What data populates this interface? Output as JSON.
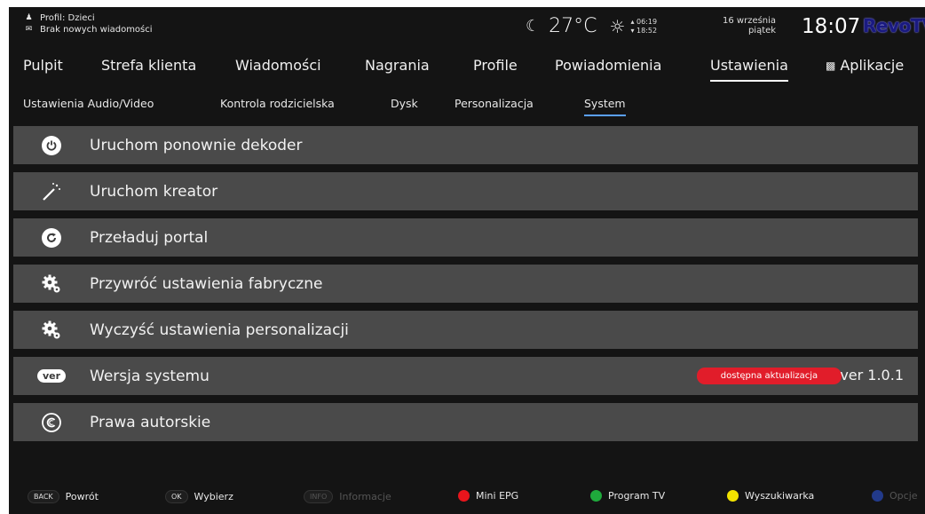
{
  "status": {
    "profile_label": "Profil: Dzieci",
    "messages_label": "Brak nowych wiadomości",
    "temperature": "27°C",
    "sunrise": "06:19",
    "sunset": "18:52",
    "date": "16 września",
    "weekday": "piątek",
    "time": "18:07",
    "brand": "RevoTV"
  },
  "main_nav": {
    "tabs": [
      "Pulpit",
      "Strefa klienta",
      "Wiadomości",
      "Nagrania",
      "Profile",
      "Powiadomienia",
      "Ustawienia",
      "Aplikacje"
    ],
    "active": "Ustawienia"
  },
  "sub_nav": {
    "tabs": [
      "Ustawienia Audio/Video",
      "Kontrola rodzicielska",
      "Dysk",
      "Personalizacja",
      "System"
    ],
    "active": "System"
  },
  "menu": {
    "items": [
      {
        "label": "Uruchom ponownie dekoder",
        "icon": "power-icon"
      },
      {
        "label": "Uruchom kreator",
        "icon": "magic-wand-icon"
      },
      {
        "label": "Przeładuj portal",
        "icon": "refresh-icon"
      },
      {
        "label": "Przywróć ustawienia fabryczne",
        "icon": "gears-icon"
      },
      {
        "label": "Wyczyść ustawienia personalizacji",
        "icon": "gears-icon"
      },
      {
        "label": "Wersja systemu",
        "icon": "ver-icon",
        "icon_text": "ver",
        "badge": "dostępna aktualizacja",
        "value": "ver 1.0.1"
      },
      {
        "label": "Prawa autorskie",
        "icon": "copyright-icon"
      }
    ]
  },
  "hints": {
    "back_key": "BACK",
    "back_label": "Powrót",
    "ok_key": "OK",
    "ok_label": "Wybierz",
    "info_key": "INFO",
    "info_label": "Informacje",
    "red_label": "Mini EPG",
    "green_label": "Program TV",
    "yellow_label": "Wyszukiwarka",
    "blue_label": "Opcje"
  },
  "colors": {
    "background": "#141414",
    "item_background": "#4a4a4a",
    "active_underline_sub": "#5aa0ff",
    "badge_red": "#e11d2a",
    "red": "#e8151c",
    "green": "#1faa3c",
    "yellow": "#f2e300",
    "blue": "#223a8a"
  }
}
